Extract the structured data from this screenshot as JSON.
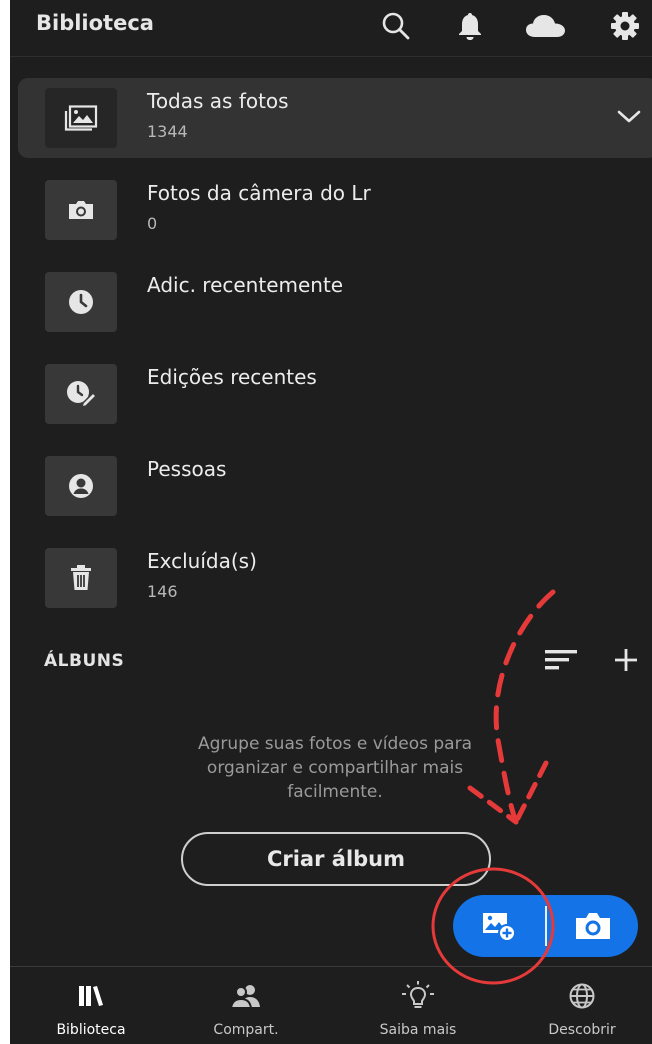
{
  "header": {
    "title": "Biblioteca",
    "icons": [
      "search-icon",
      "bell-icon",
      "cloud-icon",
      "gear-icon"
    ]
  },
  "library_items": [
    {
      "title": "Todas as fotos",
      "count": "1344",
      "icon": "photos-icon",
      "selected": true
    },
    {
      "title": "Fotos da câmera do Lr",
      "count": "0",
      "icon": "camera-icon"
    },
    {
      "title": "Adic. recentemente",
      "count": "",
      "icon": "clock-icon"
    },
    {
      "title": "Edições recentes",
      "count": "",
      "icon": "edit-history-icon"
    },
    {
      "title": "Pessoas",
      "count": "",
      "icon": "person-icon"
    },
    {
      "title": "Excluída(s)",
      "count": "146",
      "icon": "trash-icon"
    }
  ],
  "albums": {
    "title": "ÁLBUNS",
    "empty_text": "Agrupe suas fotos e vídeos para organizar e compartilhar mais facilmente.",
    "create_button": "Criar álbum"
  },
  "fab": {
    "left_icon": "add-photo-icon",
    "right_icon": "camera-icon"
  },
  "bottom_nav": [
    {
      "label": "Biblioteca",
      "icon": "library-icon",
      "active": true
    },
    {
      "label": "Compart.",
      "icon": "people-icon"
    },
    {
      "label": "Saiba mais",
      "icon": "lightbulb-icon"
    },
    {
      "label": "Descobrir",
      "icon": "globe-icon"
    }
  ],
  "colors": {
    "background": "#1e1e1e",
    "accent": "#1473e6",
    "annotation": "#e63a3a"
  }
}
